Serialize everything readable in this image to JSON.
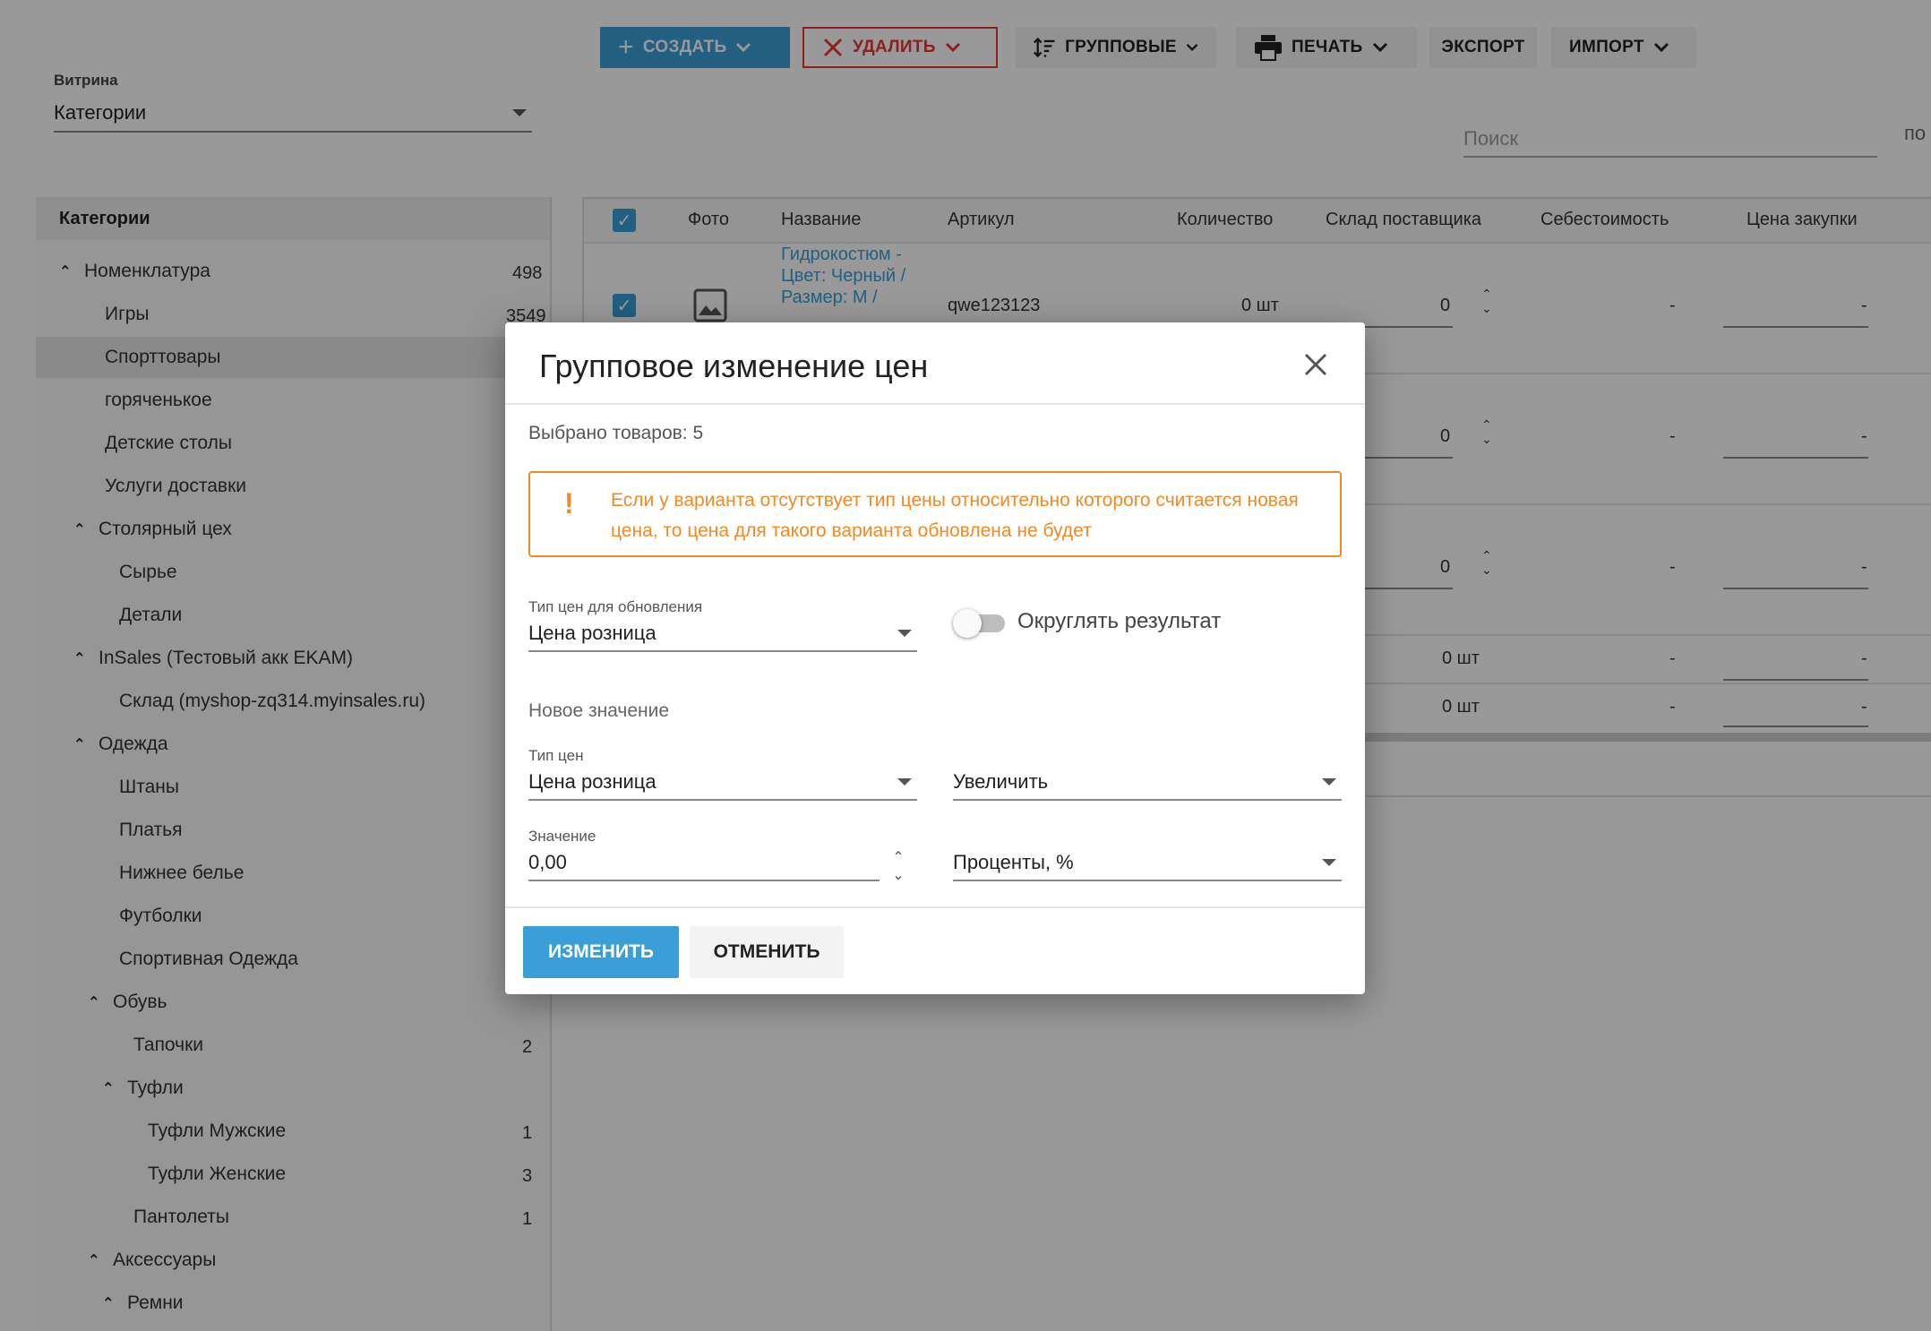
{
  "toolbar": {
    "create": "СОЗДАТЬ",
    "delete": "УДАЛИТЬ",
    "group": "ГРУППОВЫЕ",
    "print": "ПЕЧАТЬ",
    "export": "ЭКСПОРТ",
    "import": "ИМПОРТ"
  },
  "vitrina": {
    "label": "Витрина",
    "value": "Категории"
  },
  "search": {
    "placeholder": "Поиск",
    "edge_text": "по"
  },
  "sidebar": {
    "header": "Категории",
    "items": [
      {
        "label": "Номенклатура",
        "count": "498"
      },
      {
        "label": "Игры",
        "count": "3549"
      },
      {
        "label": "Спорттовары",
        "count": ""
      },
      {
        "label": "горяченькое",
        "count": ""
      },
      {
        "label": "Детские столы",
        "count": ""
      },
      {
        "label": "Услуги доставки",
        "count": ""
      },
      {
        "label": "Столярный цех",
        "count": ""
      },
      {
        "label": "Сырье",
        "count": ""
      },
      {
        "label": "Детали",
        "count": ""
      },
      {
        "label": "InSales (Тестовый акк EKAM)",
        "count": ""
      },
      {
        "label": "Склад (myshop-zq314.myinsales.ru)",
        "count": ""
      },
      {
        "label": "Одежда",
        "count": ""
      },
      {
        "label": "Штаны",
        "count": ""
      },
      {
        "label": "Платья",
        "count": ""
      },
      {
        "label": "Нижнее белье",
        "count": ""
      },
      {
        "label": "Футболки",
        "count": ""
      },
      {
        "label": "Спортивная Одежда",
        "count": ""
      },
      {
        "label": "Обувь",
        "count": ""
      },
      {
        "label": "Тапочки",
        "count": "2"
      },
      {
        "label": "Туфли",
        "count": ""
      },
      {
        "label": "Туфли Мужские",
        "count": "1"
      },
      {
        "label": "Туфли Женские",
        "count": "3"
      },
      {
        "label": "Пантолеты",
        "count": "1"
      },
      {
        "label": "Аксессуары",
        "count": ""
      },
      {
        "label": "Ремни",
        "count": ""
      }
    ]
  },
  "table": {
    "headers": [
      "Фото",
      "Название",
      "Артикул",
      "Количество",
      "Склад поставщика",
      "Себестоимость",
      "Цена закупки"
    ],
    "row1": {
      "name": "Гидрокостюм - Цвет: Черный / Размер: M /",
      "sku": "qwe123123",
      "qty": "0 шт",
      "supplier": "0",
      "cost": "-",
      "purchase": "-"
    },
    "rows": [
      {
        "supplier": "0",
        "cost": "-",
        "purchase": "-"
      },
      {
        "supplier": "0",
        "cost": "-",
        "purchase": "-"
      },
      {
        "qty": "0 шт",
        "cost": "-",
        "purchase": "-"
      },
      {
        "qty": "0 шт",
        "cost": "-",
        "purchase": "-"
      }
    ]
  },
  "modal": {
    "title": "Групповое изменение цен",
    "selected": "Выбрано товаров: 5",
    "warning": "Если у варианта отсутствует тип цены относительно которого считается новая цена, то цена для такого варианта обновлена не будет",
    "update_price_type_label": "Тип цен для обновления",
    "update_price_type_value": "Цена розница",
    "round_label": "Округлять результат",
    "round_on": false,
    "new_value_section": "Новое значение",
    "price_type_label": "Тип цен",
    "price_type_value": "Цена розница",
    "operation_value": "Увеличить",
    "value_label": "Значение",
    "value": "0,00",
    "unit_value": "Проценты, %",
    "apply": "ИЗМЕНИТЬ",
    "cancel": "ОТМЕНИТЬ"
  },
  "colors": {
    "accent": "#3a9ed8",
    "danger": "#ee3333",
    "warning": "#f08a24"
  }
}
